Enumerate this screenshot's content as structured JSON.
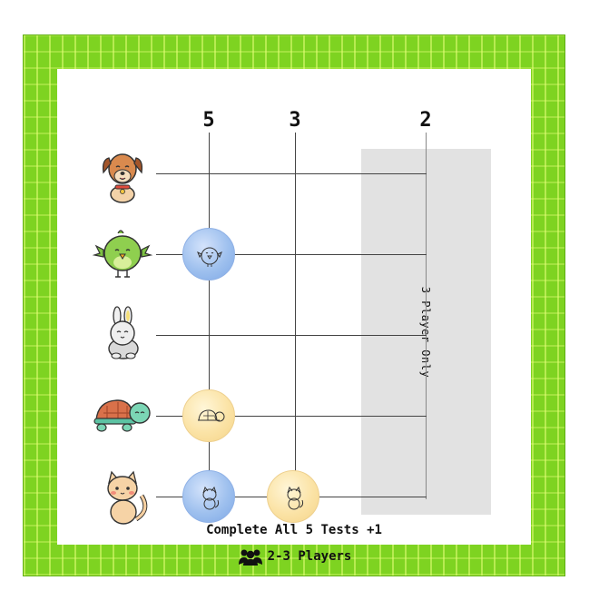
{
  "columns": [
    "5",
    "3",
    "2"
  ],
  "band_label": "3 Player Only",
  "rows": [
    {
      "animal": "dog-icon"
    },
    {
      "animal": "bird-icon"
    },
    {
      "animal": "bunny-icon"
    },
    {
      "animal": "turtle-icon"
    },
    {
      "animal": "cat-icon"
    }
  ],
  "tokens": [
    {
      "row": "bird",
      "column": "5",
      "color": "blue",
      "icon": "bird-icon"
    },
    {
      "row": "turtle",
      "column": "5",
      "color": "yellow",
      "icon": "turtle-icon"
    },
    {
      "row": "cat",
      "column": "5",
      "color": "blue",
      "icon": "cat-icon"
    },
    {
      "row": "cat",
      "column": "3",
      "color": "yellow",
      "icon": "cat-icon"
    }
  ],
  "bonus_text": "Complete All 5 Tests +1",
  "players_text": "2-3 Players",
  "players_icon": "people-icon",
  "colors": {
    "border": "#7ed321",
    "blue_token": "#9ec0ee",
    "yellow_token": "#fbe3a6",
    "grey_band": "#e2e2e2"
  }
}
